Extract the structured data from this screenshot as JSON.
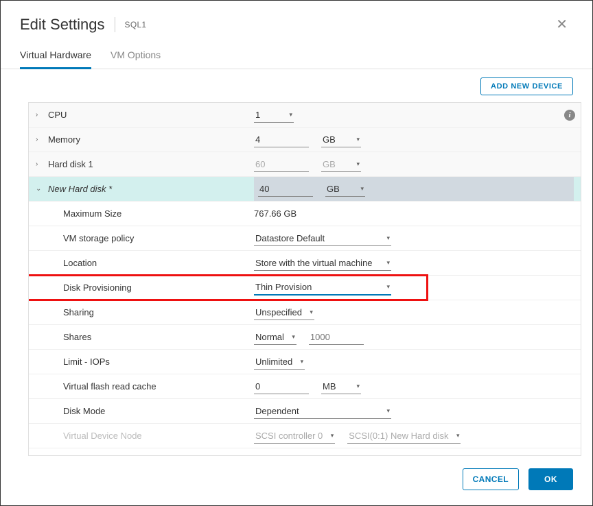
{
  "header": {
    "title": "Edit Settings",
    "vm_name": "SQL1"
  },
  "tabs": {
    "hardware": "Virtual Hardware",
    "options": "VM Options"
  },
  "toolbar": {
    "add_device": "ADD NEW DEVICE"
  },
  "rows": {
    "cpu": {
      "label": "CPU",
      "value": "1"
    },
    "memory": {
      "label": "Memory",
      "value": "4",
      "unit": "GB"
    },
    "hdd1": {
      "label": "Hard disk 1",
      "value": "60",
      "unit": "GB"
    },
    "new_hdd": {
      "label": "New Hard disk *",
      "value": "40",
      "unit": "GB"
    },
    "max_size": {
      "label": "Maximum Size",
      "value": "767.66 GB"
    },
    "storage_policy": {
      "label": "VM storage policy",
      "value": "Datastore Default"
    },
    "location": {
      "label": "Location",
      "value": "Store with the virtual machine"
    },
    "disk_prov": {
      "label": "Disk Provisioning",
      "value": "Thin Provision"
    },
    "sharing": {
      "label": "Sharing",
      "value": "Unspecified"
    },
    "shares": {
      "label": "Shares",
      "value1": "Normal",
      "value2": "1000"
    },
    "limit": {
      "label": "Limit - IOPs",
      "value": "Unlimited"
    },
    "vfrc": {
      "label": "Virtual flash read cache",
      "value": "0",
      "unit": "MB"
    },
    "disk_mode": {
      "label": "Disk Mode",
      "value": "Dependent"
    },
    "vdn": {
      "label": "Virtual Device Node",
      "value1": "SCSI controller 0",
      "value2": "SCSI(0:1) New Hard disk"
    }
  },
  "footer": {
    "cancel": "CANCEL",
    "ok": "OK"
  }
}
